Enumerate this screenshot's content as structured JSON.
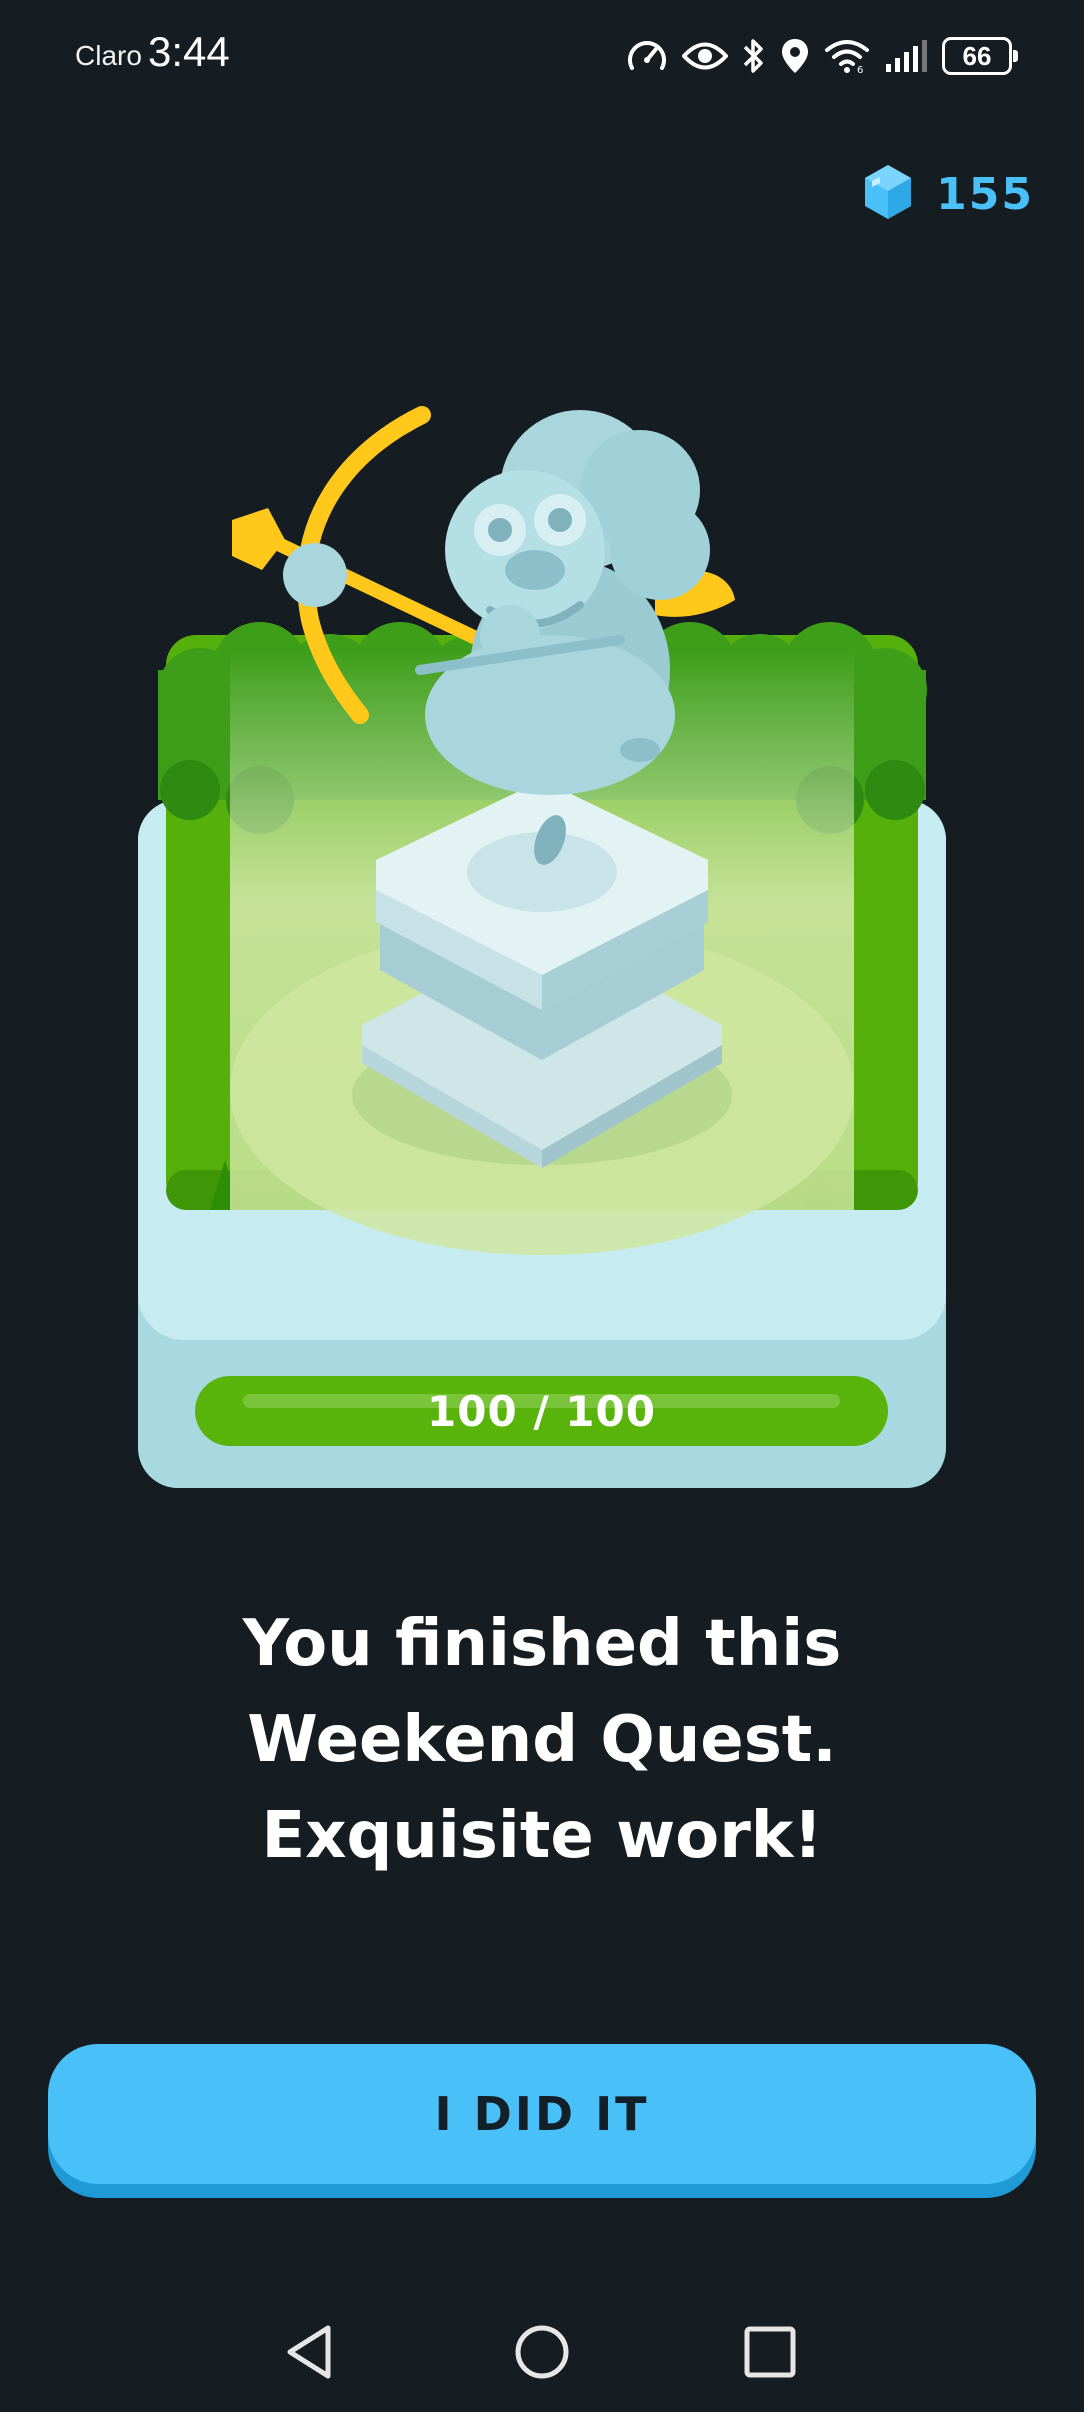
{
  "status_bar": {
    "carrier": "Claro",
    "time": "3:44",
    "battery": "66",
    "icons": [
      "speedometer-icon",
      "eye-icon",
      "bluetooth-icon",
      "location-icon",
      "wifi-icon",
      "signal-icon",
      "battery-icon"
    ]
  },
  "gems": {
    "icon": "gem-icon",
    "count": "155",
    "color": "#49c0f8"
  },
  "quest_card": {
    "illustration": "cupid-statue-illustration",
    "progress_label": "100 / 100",
    "progress_fraction": 1.0,
    "bar_color": "#58b30a"
  },
  "message": {
    "headline": "You finished this Weekend Quest. Exquisite work!"
  },
  "cta": {
    "label": "I DID IT",
    "color": "#49c0f8"
  },
  "nav": {
    "icons": [
      "back-icon",
      "home-icon",
      "recents-icon"
    ]
  }
}
